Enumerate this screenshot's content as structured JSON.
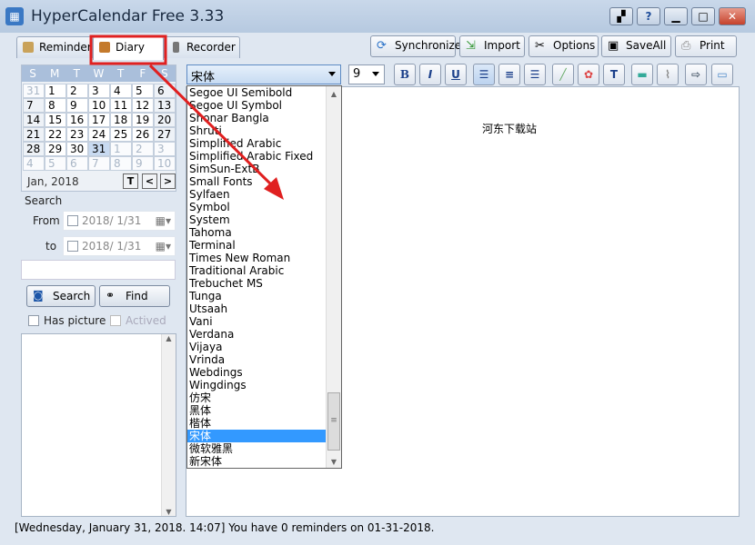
{
  "window": {
    "title": "HyperCalendar Free 3.33",
    "controls": [
      "palette",
      "help",
      "minimize",
      "maximize",
      "close"
    ]
  },
  "tabs": [
    {
      "label": "Reminder"
    },
    {
      "label": "Diary",
      "active": true
    },
    {
      "label": "Recorder"
    }
  ],
  "toolbar": {
    "buttons": [
      {
        "label": "Synchronize",
        "icon": "sync-icon"
      },
      {
        "label": "Import",
        "icon": "import-icon"
      },
      {
        "label": "Options",
        "icon": "tools-icon"
      },
      {
        "label": "SaveAll",
        "icon": "save-icon"
      },
      {
        "label": "Print",
        "icon": "print-icon"
      }
    ]
  },
  "format": {
    "font": "宋体",
    "size": "9",
    "buttons": [
      "B",
      "I",
      "U",
      "align-left",
      "align-center",
      "align-right",
      "color-picker",
      "palette",
      "text-box",
      "image",
      "attachment",
      "export",
      "folder"
    ]
  },
  "calendar": {
    "weekdays": [
      "S",
      "M",
      "T",
      "W",
      "T",
      "F",
      "S"
    ],
    "days": [
      [
        "31",
        "1",
        "2",
        "3",
        "4",
        "5",
        "6"
      ],
      [
        "7",
        "8",
        "9",
        "10",
        "11",
        "12",
        "13"
      ],
      [
        "14",
        "15",
        "16",
        "17",
        "18",
        "19",
        "20"
      ],
      [
        "21",
        "22",
        "23",
        "24",
        "25",
        "26",
        "27"
      ],
      [
        "28",
        "29",
        "30",
        "31",
        "1",
        "2",
        "3"
      ],
      [
        "4",
        "5",
        "6",
        "7",
        "8",
        "9",
        "10"
      ]
    ],
    "month_label": "Jan, 2018",
    "today_btn": "T",
    "prev_btn": "<",
    "next_btn": ">",
    "selected": "31"
  },
  "search": {
    "group_label": "Search",
    "from_label": "From",
    "to_label": "to",
    "from_date": "2018/  1/31",
    "to_date": "2018/  1/31",
    "keyword": "",
    "search_btn": "Search",
    "find_btn": "Find",
    "has_picture": "Has picture",
    "actived": "Actived"
  },
  "font_list": [
    "Segoe UI Semibold",
    "Segoe UI Symbol",
    "Shonar Bangla",
    "Shruti",
    "Simplified Arabic",
    "Simplified Arabic Fixed",
    "SimSun-ExtB",
    "Small Fonts",
    "Sylfaen",
    "Symbol",
    "System",
    "Tahoma",
    "Terminal",
    "Times New Roman",
    "Traditional Arabic",
    "Trebuchet MS",
    "Tunga",
    "Utsaah",
    "Vani",
    "Verdana",
    "Vijaya",
    "Vrinda",
    "Webdings",
    "Wingdings",
    "仿宋",
    "黑体",
    "楷体",
    "宋体",
    "微软雅黑",
    "新宋体"
  ],
  "font_selected": "宋体",
  "editor": {
    "text": "河东下载站"
  },
  "status": "[Wednesday, January 31, 2018. 14:07] You have 0 reminders on 01-31-2018.",
  "annotation_color": "#e02020"
}
